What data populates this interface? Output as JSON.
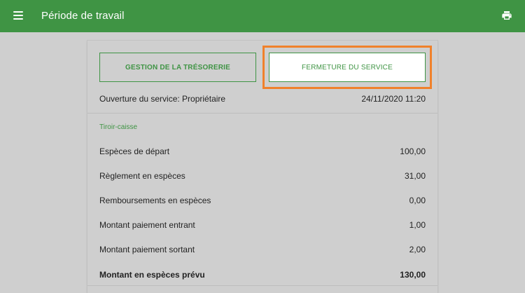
{
  "header": {
    "title": "Période de travail",
    "menu_icon": "menu-icon",
    "print_icon": "print-icon",
    "color": "#3f9444"
  },
  "buttons": {
    "treasury": "GESTION DE LA TRÉSORERIE",
    "close_service": "FERMETURE DU SERVICE"
  },
  "opening": {
    "label": "Ouverture du service: Propriétaire",
    "datetime": "24/11/2020 11:20"
  },
  "section": {
    "title": "Tiroir-caisse"
  },
  "rows": [
    {
      "label": "Espèces de départ",
      "value": "100,00"
    },
    {
      "label": "Règlement en espèces",
      "value": "31,00"
    },
    {
      "label": "Remboursements en espèces",
      "value": "0,00"
    },
    {
      "label": "Montant paiement entrant",
      "value": "1,00"
    },
    {
      "label": "Montant paiement sortant",
      "value": "2,00"
    },
    {
      "label": "Montant en espèces prévu",
      "value": "130,00"
    }
  ],
  "highlight_color": "#f0812b"
}
